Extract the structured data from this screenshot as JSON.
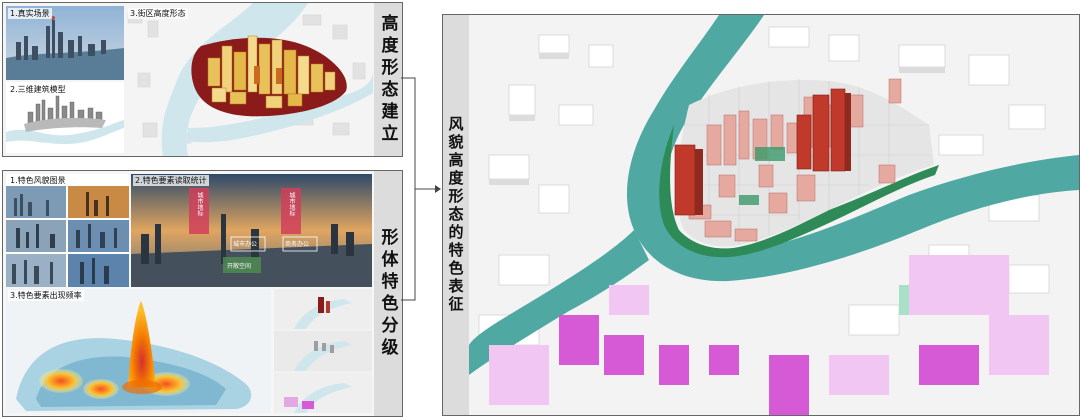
{
  "panel_a": {
    "side_title": "高度形态建立",
    "caption_1": "1.真实场景",
    "caption_2": "2.三维建筑模型",
    "caption_3": "3.街区高度形态"
  },
  "panel_b": {
    "side_title": "形体特色分级",
    "caption_1": "1.特色风貌图景",
    "caption_2": "2.特色要素读取统计",
    "caption_3": "3.特色要素出现频率",
    "banner_left": "城市地标",
    "banner_right": "城市地标",
    "tag_1": "城市办公",
    "tag_2": "商务办公",
    "tag_3": "开敞空间"
  },
  "panel_c": {
    "side_title": "风貌高度形态的特色表征"
  },
  "colors": {
    "river": "#4fa9a2",
    "river_light": "#cfe7ec",
    "tall_red": "#c0392b",
    "pink": "#e6a9a0",
    "green_edge": "#2e8b57",
    "magenta": "#d65ad6",
    "heat_red": "#e53935",
    "heat_yellow": "#f4d03f"
  }
}
